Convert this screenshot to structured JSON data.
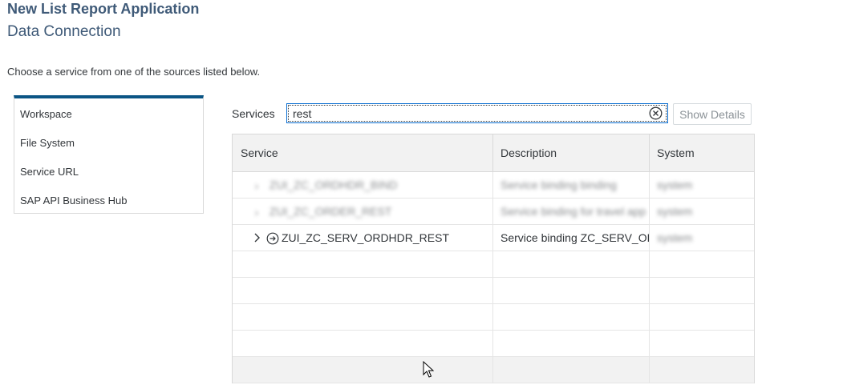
{
  "header": {
    "title": "New List Report Application",
    "subtitle": "Data Connection"
  },
  "instruction": "Choose a service from one of the sources listed below.",
  "sources": [
    {
      "label": "Workspace"
    },
    {
      "label": "File System"
    },
    {
      "label": "Service URL"
    },
    {
      "label": "SAP API Business Hub"
    }
  ],
  "search": {
    "label": "Services",
    "value": "rest"
  },
  "toolbar": {
    "show_details_label": "Show Details"
  },
  "table": {
    "columns": [
      "Service",
      "Description",
      "System"
    ],
    "rows": [
      {
        "service": "ZUI_ZC_ORDHDR_BIND",
        "description": "Service binding binding",
        "system": "system"
      },
      {
        "service": "ZUI_ZC_ORDER_REST",
        "description": "Service binding for travel app",
        "system": "system"
      },
      {
        "service": "ZUI_ZC_SERV_ORDHDR_REST",
        "description": "Service binding ZC_SERV_OR",
        "system": "system"
      }
    ]
  },
  "colors": {
    "accent": "#0b5585",
    "title": "#3f5a78",
    "focus": "#0a6ed1"
  }
}
